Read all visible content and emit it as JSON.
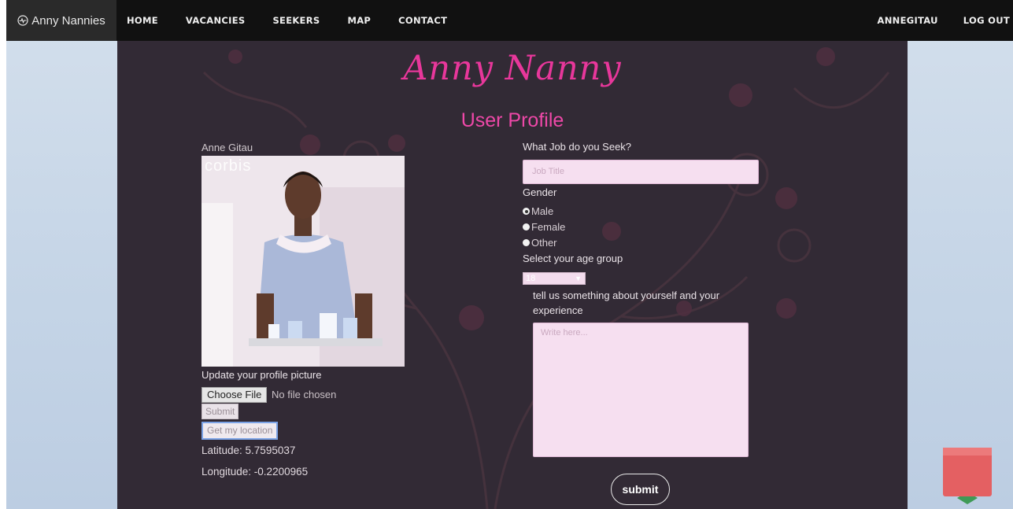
{
  "navbar": {
    "brand": "Anny Nannies",
    "brand_icon": "heartbeat-icon",
    "links": [
      "HOME",
      "VACANCIES",
      "SEEKERS",
      "MAP",
      "CONTACT"
    ],
    "user": "ANNEGITAU",
    "logout": "LOG OUT"
  },
  "header": {
    "title": "Anny Nanny",
    "subtitle": "User Profile"
  },
  "profile": {
    "name": "Anne Gitau",
    "photo_watermark": "corbis",
    "update_label": "Update your profile picture",
    "choose_file": "Choose File",
    "file_status": "No file chosen",
    "upload_submit": "Submit",
    "location_button": "Get my location",
    "latitude": "Latitude: 5.7595037",
    "longitude": "Longitude: -0.2200965"
  },
  "form": {
    "job_label": "What Job do you Seek?",
    "job_placeholder": "Job Title",
    "gender_label": "Gender",
    "gender_options": [
      "Male",
      "Female",
      "Other"
    ],
    "gender_selected": "Male",
    "age_label": "Select your age group",
    "age_value": "18",
    "about_label": "tell us something about yourself and your experience",
    "about_placeholder": "Write here...",
    "submit": "submit"
  },
  "colors": {
    "navbar": "#111111",
    "panel": "#322a35",
    "accent_pink": "#e8379b",
    "input_bg": "#f6dff0",
    "sky": "#c7d6e6"
  }
}
